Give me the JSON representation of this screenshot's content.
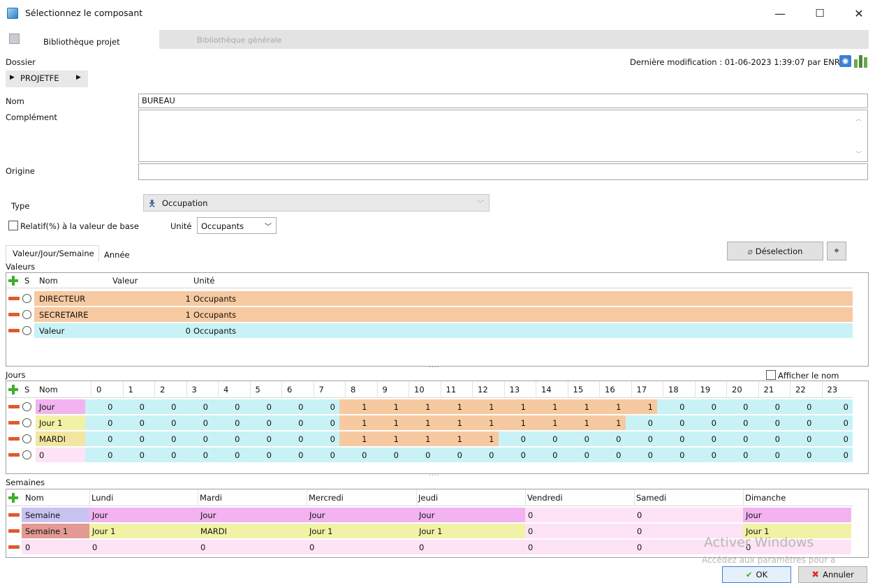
{
  "window": {
    "title": "Sélectionnez le composant",
    "minimize": "—",
    "maximize": "☐",
    "close": "✕"
  },
  "tabs": {
    "project": "Bibliothèque projet",
    "general": "Bibliothèque générale"
  },
  "folder": {
    "label": "Dossier",
    "path": "PROJETFE"
  },
  "last_modified": "Dernière modification : 01-06-2023 1:39:07 par ENR",
  "fields": {
    "nom_label": "Nom",
    "nom_value": "BUREAU",
    "complement_label": "Complément",
    "complement_value": "",
    "origine_label": "Origine",
    "origine_value": ""
  },
  "type": {
    "label": "Type",
    "value": "Occupation"
  },
  "relative": {
    "label": "Relatif(%) à la valeur de base",
    "checked": false
  },
  "unite": {
    "label": "Unité",
    "value": "Occupants"
  },
  "subtabs": {
    "vjs": "Valeur/Jour/Semaine",
    "annee": "Année"
  },
  "deselect_label": "Déselection",
  "valeurs": {
    "title": "Valeurs",
    "headers": {
      "s": "S",
      "nom": "Nom",
      "valeur": "Valeur",
      "unite": "Unité"
    },
    "rows": [
      {
        "nom": "DIRECTEUR",
        "valeur": "1",
        "unite": "Occupants",
        "color": "#f7c9a0"
      },
      {
        "nom": "SECRETAIRE",
        "valeur": "1",
        "unite": "Occupants",
        "color": "#f7c9a0"
      },
      {
        "nom": "Valeur",
        "valeur": "0",
        "unite": "Occupants",
        "color": "#c8f2f5"
      }
    ]
  },
  "jours": {
    "title": "Jours",
    "show_name_label": "Afficher le nom",
    "headers": {
      "s": "S",
      "nom": "Nom"
    },
    "hours": [
      "0",
      "1",
      "2",
      "3",
      "4",
      "5",
      "6",
      "7",
      "8",
      "9",
      "10",
      "11",
      "12",
      "13",
      "14",
      "15",
      "16",
      "17",
      "18",
      "19",
      "20",
      "21",
      "22",
      "23"
    ],
    "rows": [
      {
        "nom": "Jour",
        "name_color": "#f2b3f0",
        "values": [
          "0",
          "0",
          "0",
          "0",
          "0",
          "0",
          "0",
          "0",
          "1",
          "1",
          "1",
          "1",
          "1",
          "1",
          "1",
          "1",
          "1",
          "1",
          "0",
          "0",
          "0",
          "0",
          "0",
          "0"
        ]
      },
      {
        "nom": "Jour 1",
        "name_color": "#f2f2a6",
        "values": [
          "0",
          "0",
          "0",
          "0",
          "0",
          "0",
          "0",
          "0",
          "1",
          "1",
          "1",
          "1",
          "1",
          "1",
          "1",
          "1",
          "1",
          "0",
          "0",
          "0",
          "0",
          "0",
          "0",
          "0"
        ]
      },
      {
        "nom": "MARDI",
        "name_color": "#f2e6a0",
        "values": [
          "0",
          "0",
          "0",
          "0",
          "0",
          "0",
          "0",
          "0",
          "1",
          "1",
          "1",
          "1",
          "1",
          "0",
          "0",
          "0",
          "0",
          "0",
          "0",
          "0",
          "0",
          "0",
          "0",
          "0"
        ]
      },
      {
        "nom": "0",
        "name_color": "#fde3f5",
        "values": [
          "0",
          "0",
          "0",
          "0",
          "0",
          "0",
          "0",
          "0",
          "0",
          "0",
          "0",
          "0",
          "0",
          "0",
          "0",
          "0",
          "0",
          "0",
          "0",
          "0",
          "0",
          "0",
          "0",
          "0"
        ]
      }
    ],
    "colors": {
      "on": "#f7c9a0",
      "off": "#c8f2f5"
    }
  },
  "semaines": {
    "title": "Semaines",
    "headers": [
      "Nom",
      "Lundi",
      "Mardi",
      "Mercredi",
      "Jeudi",
      "Vendredi",
      "Samedi",
      "Dimanche"
    ],
    "rows": [
      {
        "cells": [
          "Semaine",
          "Jour",
          "Jour",
          "Jour",
          "Jour",
          "0",
          "0",
          "Jour"
        ],
        "colors": [
          "#c9c3f2",
          "#f2b3f0",
          "#f2b3f0",
          "#f2b3f0",
          "#f2b3f0",
          "#fde3f5",
          "#fde3f5",
          "#f2b3f0"
        ]
      },
      {
        "cells": [
          "Semaine 1",
          "Jour 1",
          "MARDI",
          "Jour 1",
          "Jour 1",
          "0",
          "0",
          "Jour 1"
        ],
        "colors": [
          "#e39a94",
          "#f2f2a6",
          "#f2f2a6",
          "#f2f2a6",
          "#f2f2a6",
          "#fde3f5",
          "#fde3f5",
          "#f2f2a6"
        ]
      },
      {
        "cells": [
          "0",
          "0",
          "0",
          "0",
          "0",
          "0",
          "0",
          "0"
        ],
        "colors": [
          "#fde3f5",
          "#fde3f5",
          "#fde3f5",
          "#fde3f5",
          "#fde3f5",
          "#fde3f5",
          "#fde3f5",
          "#fde3f5"
        ]
      }
    ]
  },
  "watermark": {
    "line1": "Activer Windows",
    "line2": "Accédez aux paramètres pour a"
  },
  "buttons": {
    "ok": "OK",
    "cancel": "Annuler"
  }
}
